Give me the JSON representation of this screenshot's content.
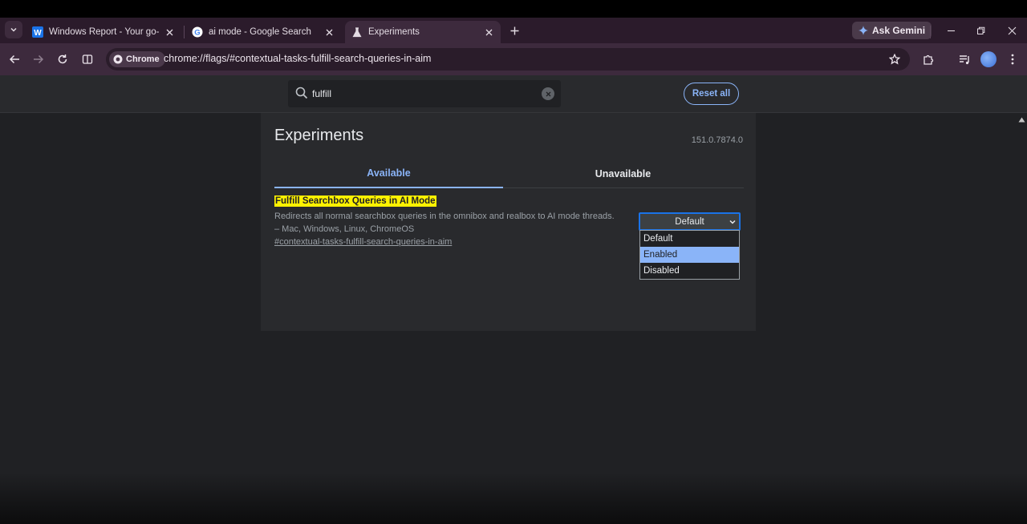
{
  "browser": {
    "tabs": [
      {
        "title": "Windows Report - Your go-to so",
        "active": false
      },
      {
        "title": "ai mode - Google Search",
        "active": false
      },
      {
        "title": "Experiments",
        "active": true
      }
    ],
    "gemini_label": "Ask Gemini",
    "chip_label": "Chrome",
    "url": "chrome://flags/#contextual-tasks-fulfill-search-queries-in-aim"
  },
  "flags_header": {
    "search_value": "fulfill",
    "reset_label": "Reset all"
  },
  "page": {
    "title": "Experiments",
    "version": "151.0.7874.0",
    "tab_available": "Available",
    "tab_unavailable": "Unavailable"
  },
  "experiment": {
    "name": "Fulfill Searchbox Queries in AI Mode",
    "description": "Redirects all normal searchbox queries in the omnibox and realbox to AI mode threads. – Mac, Windows, Linux, ChromeOS",
    "link": "#contextual-tasks-fulfill-search-queries-in-aim",
    "selected": "Default",
    "options": [
      "Default",
      "Enabled",
      "Disabled"
    ],
    "highlighted_option": "Enabled"
  },
  "colors": {
    "accent": "#8ab4f8",
    "highlight": "#fff200",
    "tab_strip": "#2b1b2b",
    "toolbar": "#3d2a3d"
  }
}
